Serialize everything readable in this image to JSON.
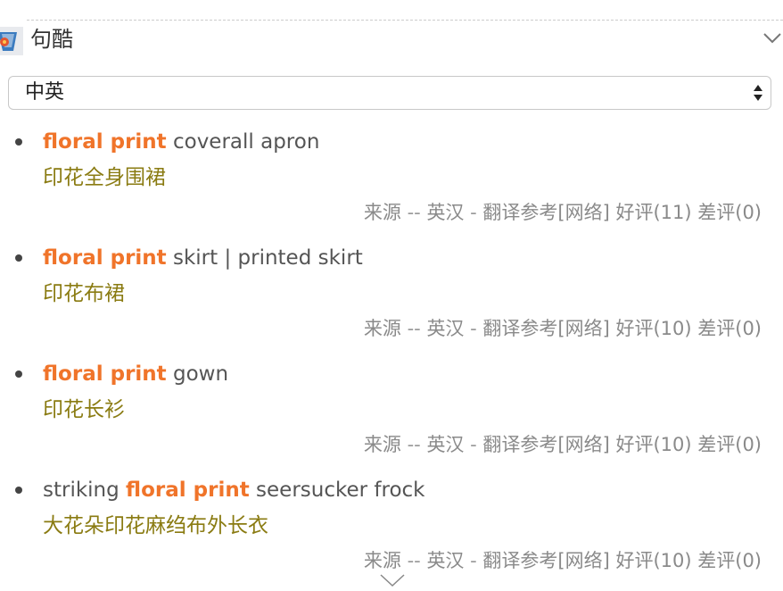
{
  "section": {
    "title": "句酷",
    "logo_icon": "jukuu-logo-icon",
    "collapse_icon": "chevron-down-icon"
  },
  "language_select": {
    "value": "中英",
    "icon": "select-arrows-icon"
  },
  "sentences": [
    {
      "english_prefix": "",
      "keyword": "floral print",
      "english_suffix": " coverall apron",
      "chinese": "印花全身围裙",
      "source_label": "来源",
      "source_sep": " -- ",
      "source_dict": "英汉",
      "source_sep2": " - ",
      "reference": "翻译参考[网络]",
      "good_label": "好评",
      "good_count": "(11)",
      "bad_label": "差评",
      "bad_count": "(0)"
    },
    {
      "english_prefix": "",
      "keyword": "floral print",
      "english_suffix": " skirt | printed skirt",
      "chinese": "印花布裙",
      "source_label": "来源",
      "source_sep": " -- ",
      "source_dict": "英汉",
      "source_sep2": " - ",
      "reference": "翻译参考[网络]",
      "good_label": "好评",
      "good_count": "(10)",
      "bad_label": "差评",
      "bad_count": "(0)"
    },
    {
      "english_prefix": "",
      "keyword": "floral print",
      "english_suffix": " gown",
      "chinese": "印花长衫",
      "source_label": "来源",
      "source_sep": " -- ",
      "source_dict": "英汉",
      "source_sep2": " - ",
      "reference": "翻译参考[网络]",
      "good_label": "好评",
      "good_count": "(10)",
      "bad_label": "差评",
      "bad_count": "(0)"
    },
    {
      "english_prefix": "striking ",
      "keyword": "floral print",
      "english_suffix": " seersucker frock",
      "chinese": "大花朵印花麻绉布外长衣",
      "source_label": "来源",
      "source_sep": " -- ",
      "source_dict": "英汉",
      "source_sep2": " - ",
      "reference": "翻译参考[网络]",
      "good_label": "好评",
      "good_count": "(10)",
      "bad_label": "差评",
      "bad_count": "(0)"
    }
  ],
  "expand_icon": "chevron-down-icon",
  "colors": {
    "keyword": "#f0742a",
    "chinese": "#8a7b12",
    "meta": "#8a8a8a"
  }
}
